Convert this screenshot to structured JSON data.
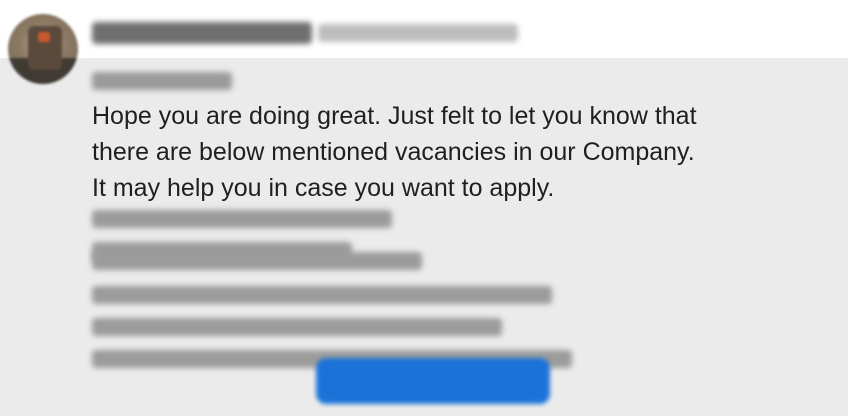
{
  "message": {
    "lines": [
      "Hope you are doing great. Just felt to let you know that",
      "there are below mentioned vacancies in our Company.",
      "It may help you in case you want to apply."
    ]
  },
  "colors": {
    "background": "#ebebeb",
    "header": "#ffffff",
    "text": "#1f1f1f",
    "button": "#1b73d8",
    "redaction": "#9b9b9b"
  },
  "icons": {
    "avatar": "profile-photo"
  }
}
